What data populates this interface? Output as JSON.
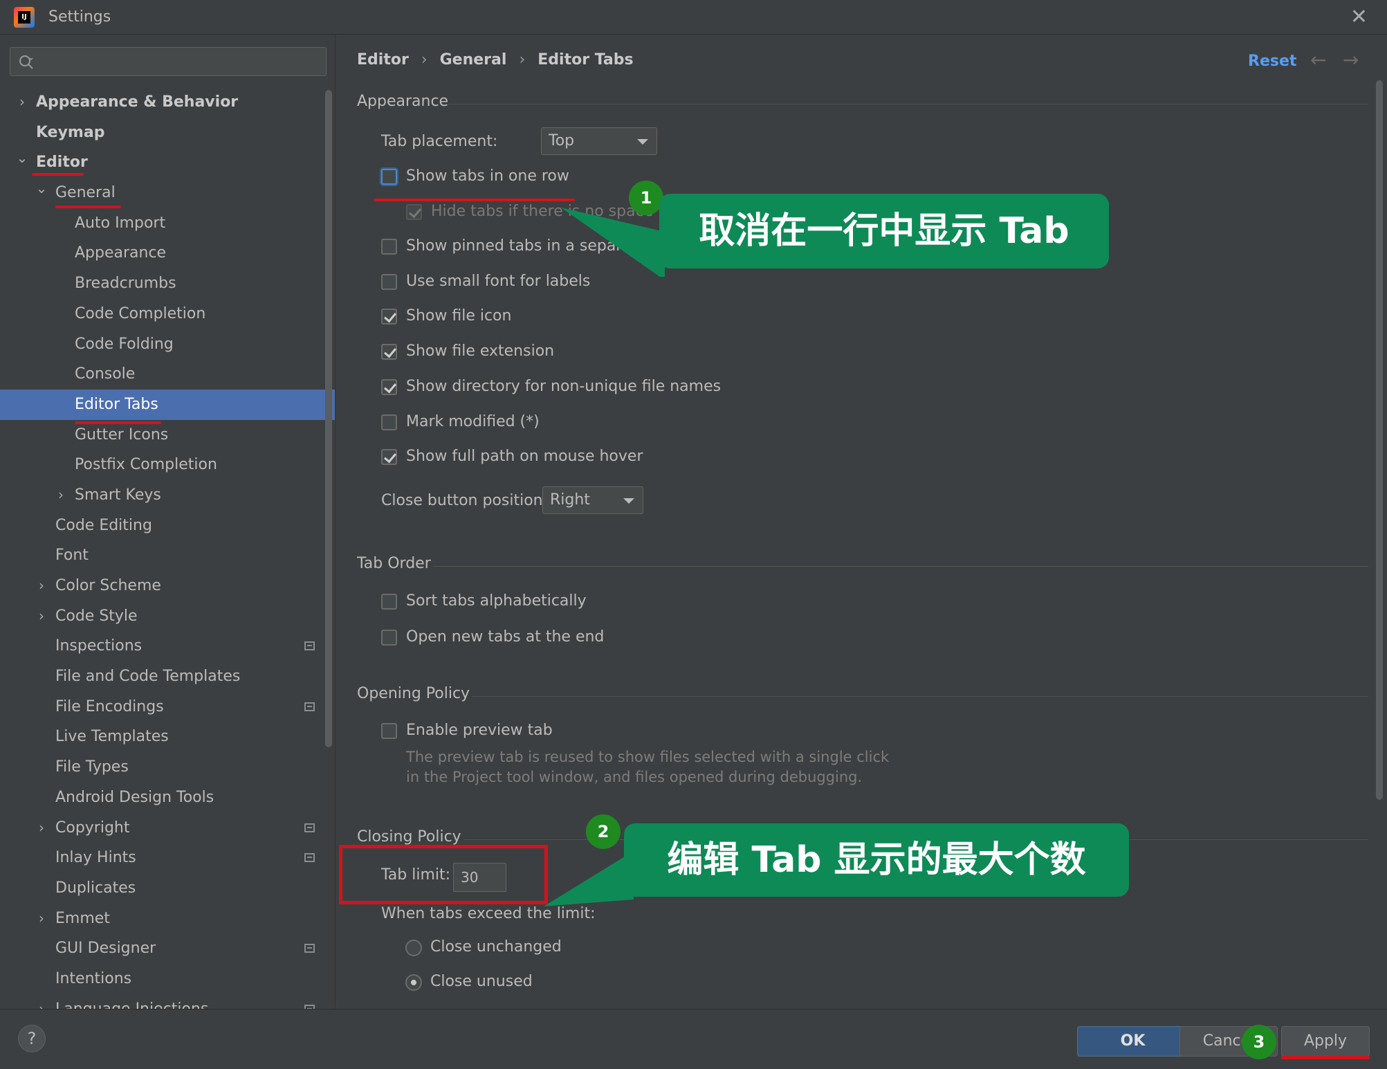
{
  "window": {
    "title": "Settings"
  },
  "search": {
    "placeholder": ""
  },
  "sidebar": {
    "items": [
      {
        "label": "Appearance & Behavior",
        "level": 0,
        "chevron": "right",
        "bold": true
      },
      {
        "label": "Keymap",
        "level": 0,
        "chevron": "",
        "bold": true
      },
      {
        "label": "Editor",
        "level": 0,
        "chevron": "down",
        "bold": true
      },
      {
        "label": "General",
        "level": 1,
        "chevron": "down"
      },
      {
        "label": "Auto Import",
        "level": 2,
        "chevron": ""
      },
      {
        "label": "Appearance",
        "level": 2,
        "chevron": ""
      },
      {
        "label": "Breadcrumbs",
        "level": 2,
        "chevron": ""
      },
      {
        "label": "Code Completion",
        "level": 2,
        "chevron": ""
      },
      {
        "label": "Code Folding",
        "level": 2,
        "chevron": ""
      },
      {
        "label": "Console",
        "level": 2,
        "chevron": ""
      },
      {
        "label": "Editor Tabs",
        "level": 2,
        "chevron": "",
        "selected": true
      },
      {
        "label": "Gutter Icons",
        "level": 2,
        "chevron": ""
      },
      {
        "label": "Postfix Completion",
        "level": 2,
        "chevron": ""
      },
      {
        "label": "Smart Keys",
        "level": 2,
        "chevron": "right"
      },
      {
        "label": "Code Editing",
        "level": 1,
        "chevron": ""
      },
      {
        "label": "Font",
        "level": 1,
        "chevron": ""
      },
      {
        "label": "Color Scheme",
        "level": 1,
        "chevron": "right"
      },
      {
        "label": "Code Style",
        "level": 1,
        "chevron": "right"
      },
      {
        "label": "Inspections",
        "level": 1,
        "chevron": "",
        "project_icon": true
      },
      {
        "label": "File and Code Templates",
        "level": 1,
        "chevron": ""
      },
      {
        "label": "File Encodings",
        "level": 1,
        "chevron": "",
        "project_icon": true
      },
      {
        "label": "Live Templates",
        "level": 1,
        "chevron": ""
      },
      {
        "label": "File Types",
        "level": 1,
        "chevron": ""
      },
      {
        "label": "Android Design Tools",
        "level": 1,
        "chevron": ""
      },
      {
        "label": "Copyright",
        "level": 1,
        "chevron": "right",
        "project_icon": true
      },
      {
        "label": "Inlay Hints",
        "level": 1,
        "chevron": "",
        "project_icon": true
      },
      {
        "label": "Duplicates",
        "level": 1,
        "chevron": ""
      },
      {
        "label": "Emmet",
        "level": 1,
        "chevron": "right"
      },
      {
        "label": "GUI Designer",
        "level": 1,
        "chevron": "",
        "project_icon": true
      },
      {
        "label": "Intentions",
        "level": 1,
        "chevron": ""
      },
      {
        "label": "Language Injections",
        "level": 1,
        "chevron": "right",
        "project_icon": true
      }
    ]
  },
  "breadcrumb": [
    "Editor",
    "General",
    "Editor Tabs"
  ],
  "header": {
    "reset_label": "Reset",
    "back_icon": "arrow-left-icon",
    "forward_icon": "arrow-right-icon"
  },
  "appearance": {
    "title": "Appearance",
    "tab_placement_label": "Tab placement:",
    "tab_placement_value": "Top",
    "options": [
      {
        "label": "Show tabs in one row",
        "checked": false,
        "focused": true
      },
      {
        "label": "Hide tabs if there is no space",
        "checked": true,
        "disabled": true
      },
      {
        "label": "Show pinned tabs in a separate row",
        "checked": false
      },
      {
        "label": "Use small font for labels",
        "checked": false
      },
      {
        "label": "Show file icon",
        "checked": true
      },
      {
        "label": "Show file extension",
        "checked": true
      },
      {
        "label": "Show directory for non-unique file names",
        "checked": true
      },
      {
        "label": "Mark modified (*)",
        "checked": false
      },
      {
        "label": "Show full path on mouse hover",
        "checked": true
      }
    ],
    "close_button_label": "Close button position:",
    "close_button_value": "Right"
  },
  "tab_order": {
    "title": "Tab Order",
    "options": [
      {
        "label": "Sort tabs alphabetically",
        "checked": false
      },
      {
        "label": "Open new tabs at the end",
        "checked": false
      }
    ]
  },
  "opening_policy": {
    "title": "Opening Policy",
    "preview_label": "Enable preview tab",
    "preview_checked": false,
    "hint_line1": "The preview tab is reused to show files selected with a single click",
    "hint_line2": "in the Project tool window, and files opened during debugging."
  },
  "closing_policy": {
    "title": "Closing Policy",
    "tab_limit_label": "Tab limit:",
    "tab_limit_value": "30",
    "exceed_label": "When tabs exceed the limit:",
    "radios": [
      {
        "label": "Close unchanged",
        "checked": false
      },
      {
        "label": "Close unused",
        "checked": true
      }
    ]
  },
  "annotations": {
    "callout1": "取消在一行中显示 Tab",
    "callout2": "编辑 Tab 显示的最大个数",
    "badge1": "1",
    "badge2": "2",
    "badge3": "3"
  },
  "footer": {
    "ok_label": "OK",
    "cancel_label": "Cancel",
    "apply_label": "Apply",
    "help_label": "?"
  },
  "colors": {
    "background": "#3c3f41",
    "selection": "#4b6eaf",
    "link": "#589df6",
    "annotation_green": "#0e8a57",
    "annotation_red": "#d0141c"
  }
}
